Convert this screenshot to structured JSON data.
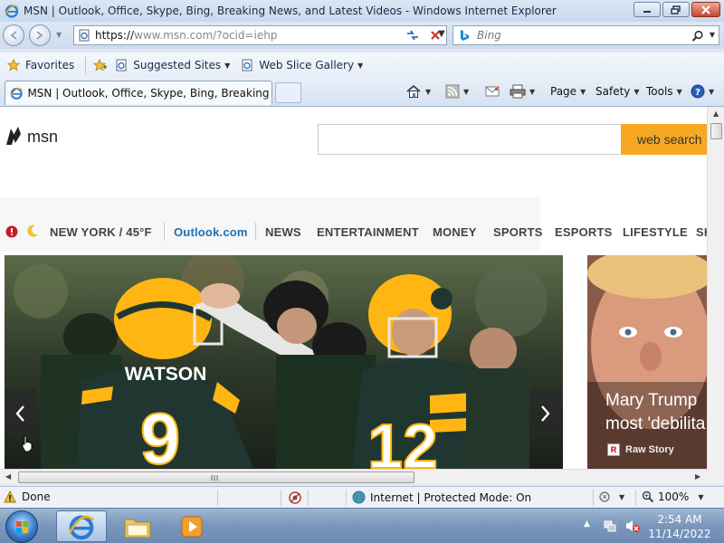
{
  "window": {
    "title": "MSN | Outlook, Office, Skype, Bing, Breaking News, and Latest Videos - Windows Internet Explorer",
    "minimize_icon": "minimize-icon",
    "restore_icon": "restore-icon",
    "close_icon": "close-icon"
  },
  "address_bar": {
    "url_scheme": "https://",
    "url_rest": "www.msn.com/?ocid=iehp"
  },
  "search_box": {
    "placeholder": "Bing"
  },
  "favorites_bar": {
    "favorites_label": "Favorites",
    "suggested_sites_label": "Suggested Sites",
    "web_slice_label": "Web Slice Gallery"
  },
  "tab": {
    "title": "MSN | Outlook, Office, Skype, Bing, Breaking Ne..."
  },
  "command_bar": {
    "page_label": "Page",
    "safety_label": "Safety",
    "tools_label": "Tools"
  },
  "msn": {
    "logo_text": "msn",
    "search_button_label": "web search",
    "nav": {
      "weather": "NEW YORK / 45°F",
      "outlook": "Outlook.com",
      "items": [
        "NEWS",
        "ENTERTAINMENT",
        "MONEY",
        "SPORTS",
        "ESPORTS",
        "LIFESTYLE",
        "SH"
      ]
    },
    "hero": {
      "jersey_name": "WATSON",
      "jersey_number_left": "9",
      "jersey_number_right": "12"
    },
    "side_card": {
      "headline_line1": "Mary Trump",
      "headline_line2": "most 'debilita",
      "source_logo": "R",
      "source": "Raw Story"
    }
  },
  "status_bar": {
    "status_text": "Done",
    "zone_text": "Internet | Protected Mode: On",
    "zoom": "100%"
  },
  "taskbar": {
    "time": "2:54 AM",
    "date": "11/14/2022"
  },
  "colors": {
    "msn_search_button": "#f6a823",
    "outlook_link": "#1f6fb4",
    "packers_green": "#203731",
    "packers_gold": "#ffb612"
  }
}
